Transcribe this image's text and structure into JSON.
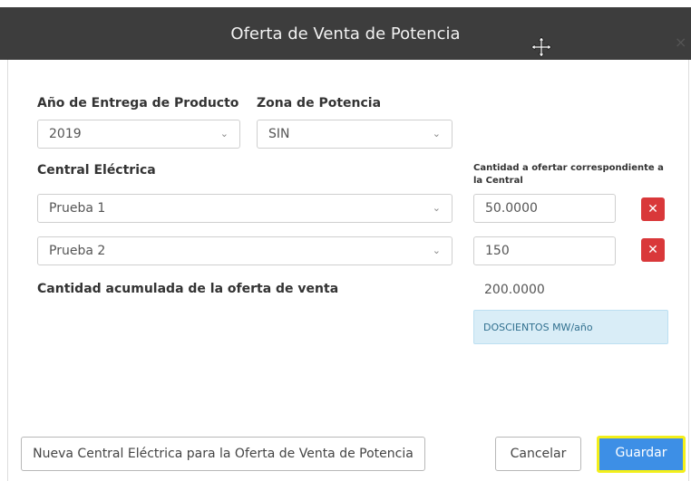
{
  "dialog": {
    "title": "Oferta de Venta de Potencia",
    "close_label": "×"
  },
  "form": {
    "year_label": "Año de Entrega de Producto",
    "year_value": "2019",
    "zone_label": "Zona de Potencia",
    "zone_value": "SIN",
    "plant_label": "Central Eléctrica",
    "quantity_label": "Cantidad a ofertar correspondiente a la Central",
    "rows": [
      {
        "plant": "Prueba 1",
        "quantity": "50.0000"
      },
      {
        "plant": "Prueba 2",
        "quantity": "150"
      }
    ],
    "total_label": "Cantidad acumulada de la oferta de venta",
    "total_value": "200.0000",
    "total_words": "DOSCIENTOS MW/año"
  },
  "footer": {
    "new_plant_label": "Nueva Central Eléctrica para la Oferta de Venta de Potencia",
    "cancel_label": "Cancelar",
    "save_label": "Guardar"
  },
  "colors": {
    "titlebar": "#3d3d3d",
    "delete": "#d9383a",
    "primary": "#3d8fe6",
    "highlight": "#f3ef1a",
    "info_bg": "#d9edf7"
  }
}
